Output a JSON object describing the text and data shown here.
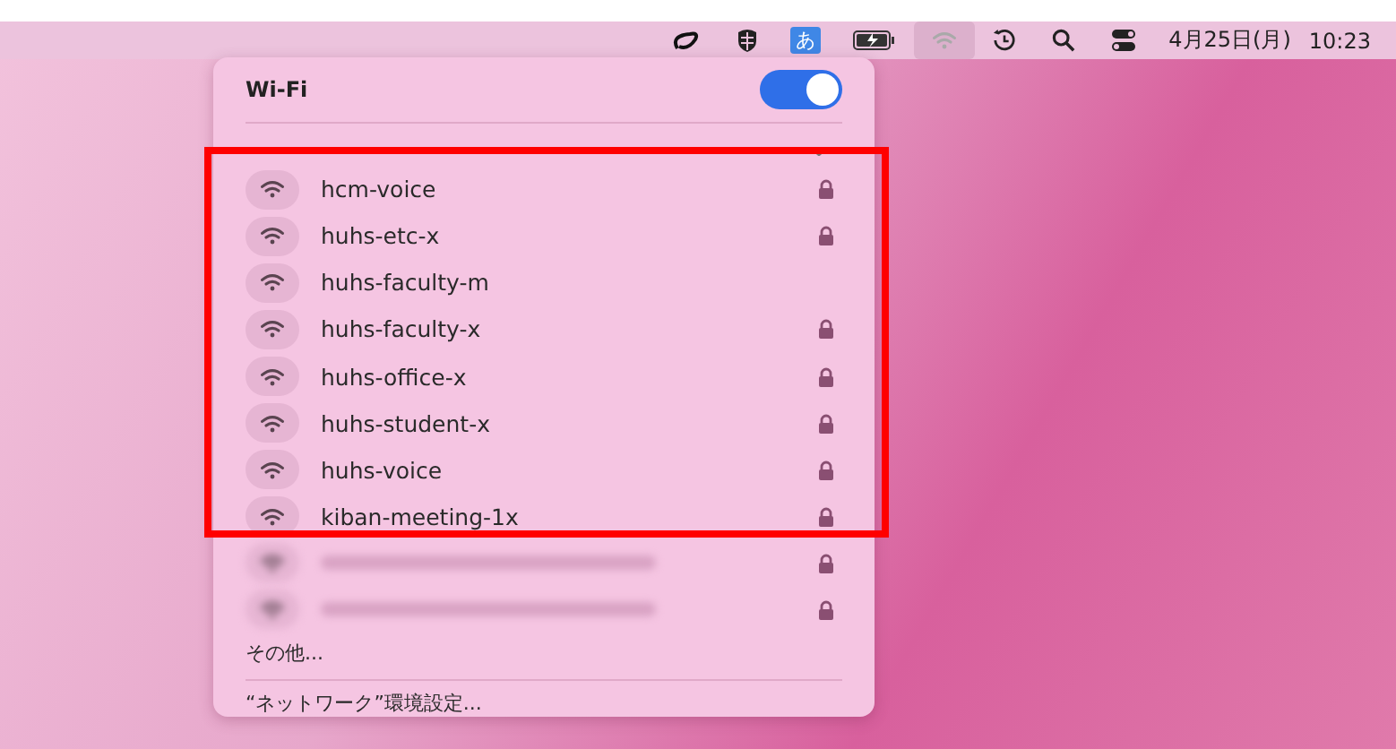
{
  "menu_bar": {
    "input_method": "あ",
    "wifi_selected": true,
    "date": "4月25日(月)",
    "time": "10:23"
  },
  "wifi_menu": {
    "title": "Wi-Fi",
    "on": true,
    "networks": [
      {
        "kind": "named",
        "name": "hcm-voice",
        "locked": true
      },
      {
        "kind": "named",
        "name": "huhs-etc-x",
        "locked": true
      },
      {
        "kind": "named",
        "name": "huhs-faculty-m",
        "locked": false
      },
      {
        "kind": "named",
        "name": "huhs-faculty-x",
        "locked": true
      },
      {
        "kind": "named",
        "name": "huhs-office-x",
        "locked": true
      },
      {
        "kind": "named",
        "name": "huhs-student-x",
        "locked": true
      },
      {
        "kind": "named",
        "name": "huhs-voice",
        "locked": true
      },
      {
        "kind": "named",
        "name": "kiban-meeting-1x",
        "locked": true
      },
      {
        "kind": "blurred",
        "locked": true
      },
      {
        "kind": "blurred",
        "locked": true
      }
    ],
    "other": "その他...",
    "preferences": "“ネットワーク”環境設定..."
  }
}
